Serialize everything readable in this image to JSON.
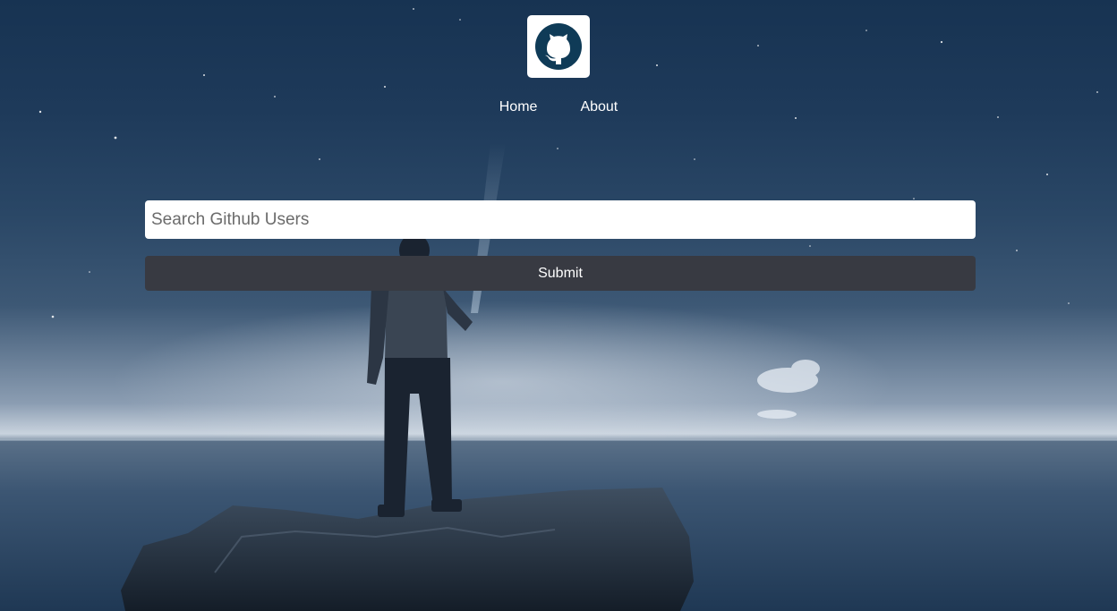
{
  "nav": {
    "logo_icon": "github-octocat-icon",
    "items": [
      {
        "label": "Home"
      },
      {
        "label": "About"
      }
    ]
  },
  "search": {
    "placeholder": "Search Github Users",
    "value": "",
    "submit_label": "Submit"
  },
  "colors": {
    "button_bg": "#383a42",
    "input_bg": "#ffffff",
    "logo_bg": "#ffffff",
    "logo_fg": "#0f3b57",
    "nav_text": "#ffffff"
  }
}
